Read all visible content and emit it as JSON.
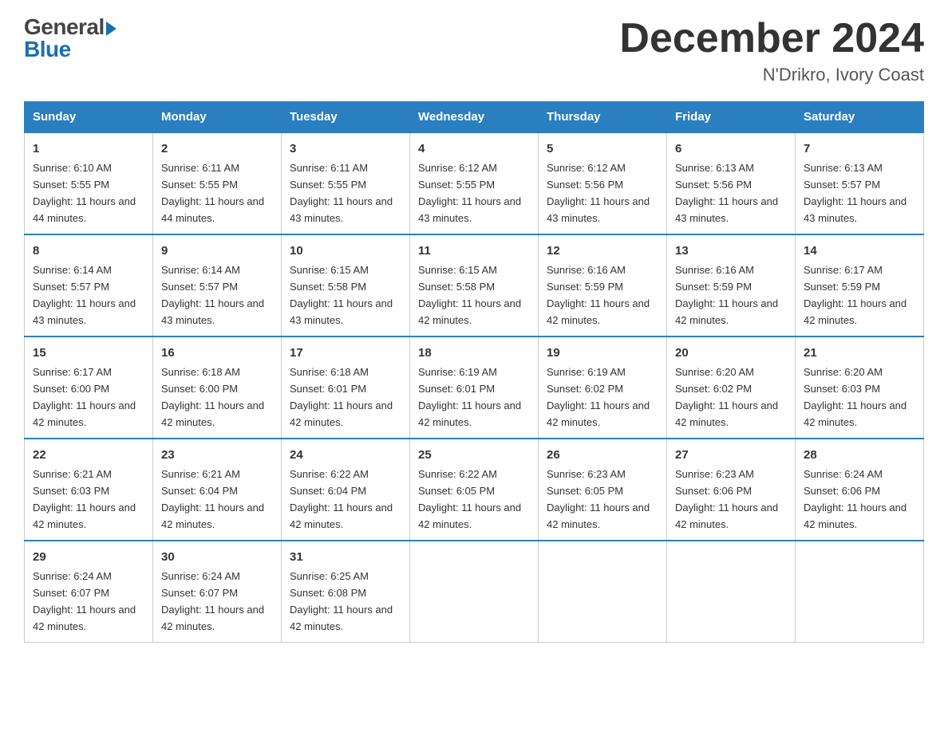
{
  "header": {
    "logo_line1": "General",
    "logo_line2": "Blue",
    "title": "December 2024",
    "subtitle": "N'Drikro, Ivory Coast"
  },
  "calendar": {
    "days_of_week": [
      "Sunday",
      "Monday",
      "Tuesday",
      "Wednesday",
      "Thursday",
      "Friday",
      "Saturday"
    ],
    "weeks": [
      [
        {
          "day": "1",
          "sunrise": "6:10 AM",
          "sunset": "5:55 PM",
          "daylight": "11 hours and 44 minutes."
        },
        {
          "day": "2",
          "sunrise": "6:11 AM",
          "sunset": "5:55 PM",
          "daylight": "11 hours and 44 minutes."
        },
        {
          "day": "3",
          "sunrise": "6:11 AM",
          "sunset": "5:55 PM",
          "daylight": "11 hours and 43 minutes."
        },
        {
          "day": "4",
          "sunrise": "6:12 AM",
          "sunset": "5:55 PM",
          "daylight": "11 hours and 43 minutes."
        },
        {
          "day": "5",
          "sunrise": "6:12 AM",
          "sunset": "5:56 PM",
          "daylight": "11 hours and 43 minutes."
        },
        {
          "day": "6",
          "sunrise": "6:13 AM",
          "sunset": "5:56 PM",
          "daylight": "11 hours and 43 minutes."
        },
        {
          "day": "7",
          "sunrise": "6:13 AM",
          "sunset": "5:57 PM",
          "daylight": "11 hours and 43 minutes."
        }
      ],
      [
        {
          "day": "8",
          "sunrise": "6:14 AM",
          "sunset": "5:57 PM",
          "daylight": "11 hours and 43 minutes."
        },
        {
          "day": "9",
          "sunrise": "6:14 AM",
          "sunset": "5:57 PM",
          "daylight": "11 hours and 43 minutes."
        },
        {
          "day": "10",
          "sunrise": "6:15 AM",
          "sunset": "5:58 PM",
          "daylight": "11 hours and 43 minutes."
        },
        {
          "day": "11",
          "sunrise": "6:15 AM",
          "sunset": "5:58 PM",
          "daylight": "11 hours and 42 minutes."
        },
        {
          "day": "12",
          "sunrise": "6:16 AM",
          "sunset": "5:59 PM",
          "daylight": "11 hours and 42 minutes."
        },
        {
          "day": "13",
          "sunrise": "6:16 AM",
          "sunset": "5:59 PM",
          "daylight": "11 hours and 42 minutes."
        },
        {
          "day": "14",
          "sunrise": "6:17 AM",
          "sunset": "5:59 PM",
          "daylight": "11 hours and 42 minutes."
        }
      ],
      [
        {
          "day": "15",
          "sunrise": "6:17 AM",
          "sunset": "6:00 PM",
          "daylight": "11 hours and 42 minutes."
        },
        {
          "day": "16",
          "sunrise": "6:18 AM",
          "sunset": "6:00 PM",
          "daylight": "11 hours and 42 minutes."
        },
        {
          "day": "17",
          "sunrise": "6:18 AM",
          "sunset": "6:01 PM",
          "daylight": "11 hours and 42 minutes."
        },
        {
          "day": "18",
          "sunrise": "6:19 AM",
          "sunset": "6:01 PM",
          "daylight": "11 hours and 42 minutes."
        },
        {
          "day": "19",
          "sunrise": "6:19 AM",
          "sunset": "6:02 PM",
          "daylight": "11 hours and 42 minutes."
        },
        {
          "day": "20",
          "sunrise": "6:20 AM",
          "sunset": "6:02 PM",
          "daylight": "11 hours and 42 minutes."
        },
        {
          "day": "21",
          "sunrise": "6:20 AM",
          "sunset": "6:03 PM",
          "daylight": "11 hours and 42 minutes."
        }
      ],
      [
        {
          "day": "22",
          "sunrise": "6:21 AM",
          "sunset": "6:03 PM",
          "daylight": "11 hours and 42 minutes."
        },
        {
          "day": "23",
          "sunrise": "6:21 AM",
          "sunset": "6:04 PM",
          "daylight": "11 hours and 42 minutes."
        },
        {
          "day": "24",
          "sunrise": "6:22 AM",
          "sunset": "6:04 PM",
          "daylight": "11 hours and 42 minutes."
        },
        {
          "day": "25",
          "sunrise": "6:22 AM",
          "sunset": "6:05 PM",
          "daylight": "11 hours and 42 minutes."
        },
        {
          "day": "26",
          "sunrise": "6:23 AM",
          "sunset": "6:05 PM",
          "daylight": "11 hours and 42 minutes."
        },
        {
          "day": "27",
          "sunrise": "6:23 AM",
          "sunset": "6:06 PM",
          "daylight": "11 hours and 42 minutes."
        },
        {
          "day": "28",
          "sunrise": "6:24 AM",
          "sunset": "6:06 PM",
          "daylight": "11 hours and 42 minutes."
        }
      ],
      [
        {
          "day": "29",
          "sunrise": "6:24 AM",
          "sunset": "6:07 PM",
          "daylight": "11 hours and 42 minutes."
        },
        {
          "day": "30",
          "sunrise": "6:24 AM",
          "sunset": "6:07 PM",
          "daylight": "11 hours and 42 minutes."
        },
        {
          "day": "31",
          "sunrise": "6:25 AM",
          "sunset": "6:08 PM",
          "daylight": "11 hours and 42 minutes."
        },
        null,
        null,
        null,
        null
      ]
    ]
  }
}
